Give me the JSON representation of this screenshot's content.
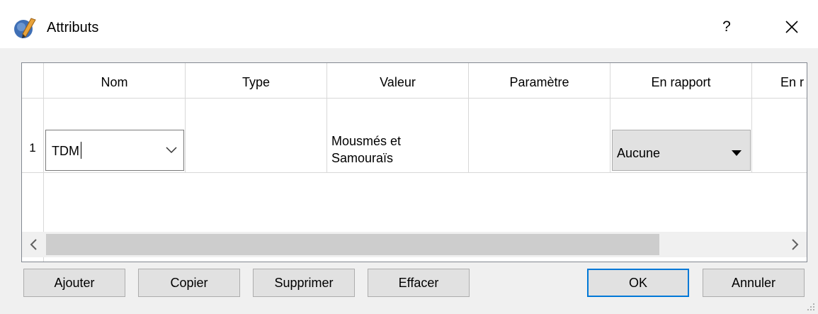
{
  "window": {
    "title": "Attributs",
    "help_label": "?",
    "icons": {
      "app": "quill-pen-icon",
      "close": "close-icon"
    }
  },
  "table": {
    "columns": [
      "Nom",
      "Type",
      "Valeur",
      "Paramètre",
      "En rapport",
      "En r"
    ],
    "rows": [
      {
        "number": "1",
        "nom": "TDM",
        "type": "",
        "valeur_line1": "Mousmés et",
        "valeur_line2": "Samouraïs",
        "parametre": "",
        "en_rapport": "Aucune"
      }
    ],
    "scroll_left_glyph": "<",
    "scroll_right_glyph": ">"
  },
  "buttons": {
    "ajouter": "Ajouter",
    "copier": "Copier",
    "supprimer": "Supprimer",
    "effacer": "Effacer",
    "ok": "OK",
    "annuler": "Annuler"
  },
  "colors": {
    "accent": "#0078d7",
    "button_bg": "#e1e1e1",
    "dialog_bg": "#f0f0f0"
  }
}
